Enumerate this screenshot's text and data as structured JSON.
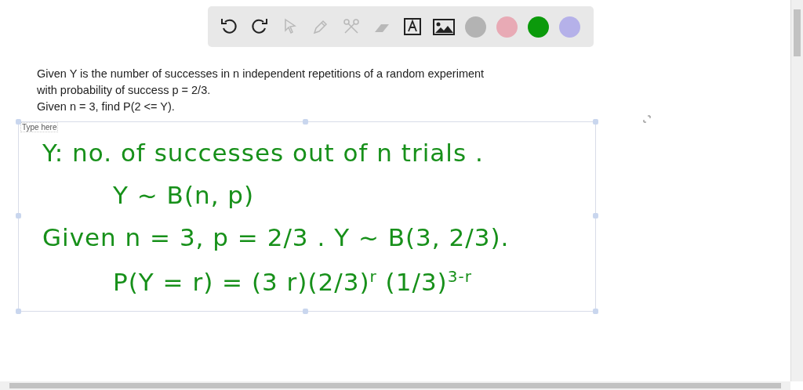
{
  "toolbar": {
    "tools": [
      {
        "kind": "undo",
        "disabled": false
      },
      {
        "kind": "redo",
        "disabled": false
      },
      {
        "kind": "pointer",
        "disabled": true
      },
      {
        "kind": "pencil",
        "disabled": true
      },
      {
        "kind": "scissors",
        "disabled": true
      },
      {
        "kind": "eraser",
        "disabled": true
      },
      {
        "kind": "text",
        "disabled": false
      },
      {
        "kind": "image",
        "disabled": false
      }
    ],
    "colors": [
      {
        "color": "#b3b3b3"
      },
      {
        "color": "#e8aab5"
      },
      {
        "color": "#0b9a0b"
      },
      {
        "color": "#b5b1e9"
      }
    ]
  },
  "question": [
    "Given Y is the number of successes in n independent repetitions of a random experiment",
    "with probability of success p = 2/3.",
    "Given n = 3, find P(2 <= Y)."
  ],
  "text_box": {
    "placeholder": "Type here"
  },
  "handwriting": [
    "Y: no. of successes out of n trials .",
    "Y ~ B(n, p)",
    "Given n = 3, p = 2/3 . Y ~ B(3, 2/3).",
    "P(Y = r) = (3 r)(2/3)$^{r}$ (1/3)$^{3-r}$"
  ]
}
